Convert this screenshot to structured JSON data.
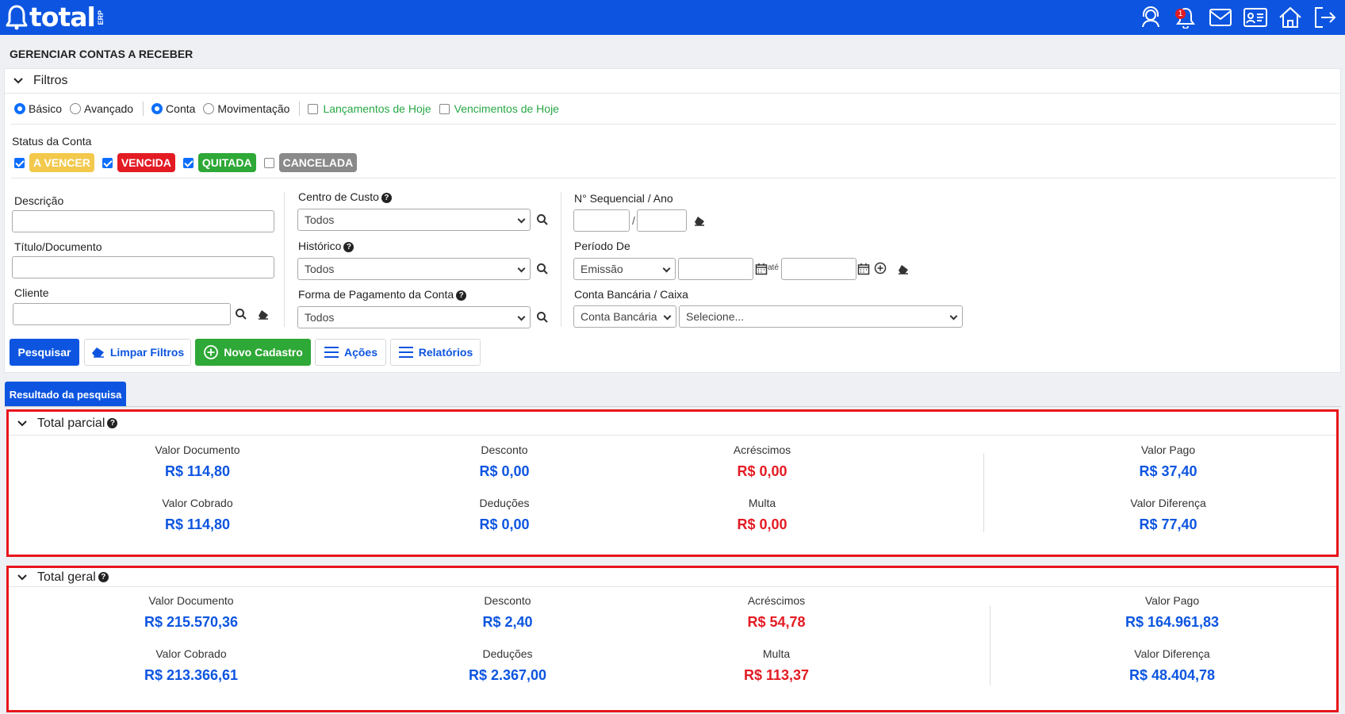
{
  "app": {
    "logo_text": "total",
    "logo_sub": "ERP",
    "notification_count": "1"
  },
  "page": {
    "title": "GERENCIAR CONTAS A RECEBER"
  },
  "filters": {
    "header": "Filtros",
    "mode": {
      "basic": "Básico",
      "advanced": "Avançado"
    },
    "view": {
      "account": "Conta",
      "movement": "Movimentação"
    },
    "quick": {
      "today_entries": "Lançamentos de Hoje",
      "today_due": "Vencimentos de Hoje"
    },
    "status_label": "Status da Conta",
    "status": [
      {
        "label": "A VENCER",
        "color": "#f2c94c",
        "checked": true
      },
      {
        "label": "VENCIDA",
        "color": "#e31b23",
        "checked": true
      },
      {
        "label": "QUITADA",
        "color": "#2ea836",
        "checked": true
      },
      {
        "label": "CANCELADA",
        "color": "#8a8a8a",
        "checked": false
      }
    ],
    "description_label": "Descrição",
    "title_label": "Título/Documento",
    "client_label": "Cliente",
    "cost_center_label": "Centro de Custo",
    "cost_center_value": "Todos",
    "history_label": "Histórico",
    "history_value": "Todos",
    "payment_label": "Forma de Pagamento da Conta",
    "payment_value": "Todos",
    "sequential_label": "N° Sequencial / Ano",
    "sequential_sep": "/",
    "period_label": "Período De",
    "period_type": "Emissão",
    "period_until": "até",
    "bank_label": "Conta Bancária / Caixa",
    "bank_type": "Conta Bancária",
    "bank_value": "Selecione..."
  },
  "actions": {
    "search": "Pesquisar",
    "clear": "Limpar Filtros",
    "new": "Novo Cadastro",
    "actions": "Ações",
    "reports": "Relatórios"
  },
  "results": {
    "tab": "Resultado da pesquisa"
  },
  "partial": {
    "title": "Total parcial",
    "valor_documento": {
      "label": "Valor Documento",
      "value": "R$ 114,80"
    },
    "desconto": {
      "label": "Desconto",
      "value": "R$ 0,00"
    },
    "acrescimos": {
      "label": "Acréscimos",
      "value": "R$ 0,00"
    },
    "valor_pago": {
      "label": "Valor Pago",
      "value": "R$ 37,40"
    },
    "valor_cobrado": {
      "label": "Valor Cobrado",
      "value": "R$ 114,80"
    },
    "deducoes": {
      "label": "Deduções",
      "value": "R$ 0,00"
    },
    "multa": {
      "label": "Multa",
      "value": "R$ 0,00"
    },
    "valor_diferenca": {
      "label": "Valor Diferença",
      "value": "R$ 77,40"
    }
  },
  "general": {
    "title": "Total geral",
    "valor_documento": {
      "label": "Valor Documento",
      "value": "R$ 215.570,36"
    },
    "desconto": {
      "label": "Desconto",
      "value": "R$ 2,40"
    },
    "acrescimos": {
      "label": "Acréscimos",
      "value": "R$ 54,78"
    },
    "valor_pago": {
      "label": "Valor Pago",
      "value": "R$ 164.961,83"
    },
    "valor_cobrado": {
      "label": "Valor Cobrado",
      "value": "R$ 213.366,61"
    },
    "deducoes": {
      "label": "Deduções",
      "value": "R$ 2.367,00"
    },
    "multa": {
      "label": "Multa",
      "value": "R$ 113,37"
    },
    "valor_diferenca": {
      "label": "Valor Diferença",
      "value": "R$ 48.404,78"
    }
  }
}
